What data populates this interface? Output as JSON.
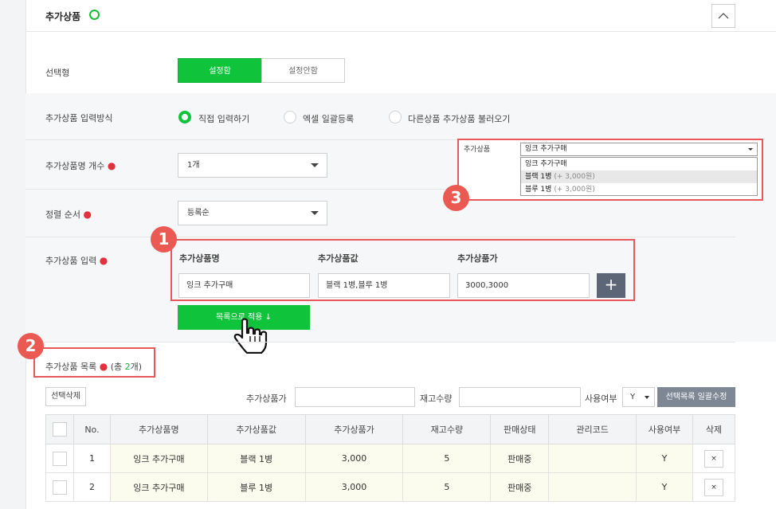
{
  "section": {
    "title": "추가상품"
  },
  "select_type": {
    "label": "선택형",
    "on_label": "설정함",
    "off_label": "설정안함"
  },
  "input_method": {
    "label": "추가상품 입력방식",
    "options": [
      "직접 입력하기",
      "엑셀 일괄등록",
      "다른상품 추가상품 불러오기"
    ],
    "selected": "직접 입력하기"
  },
  "name_count": {
    "label": "추가상품명 개수",
    "value": "1개"
  },
  "sort_order": {
    "label": "정렬 순서",
    "value": "등록순"
  },
  "product_input": {
    "label": "추가상품 입력",
    "columns": [
      "추가상품명",
      "추가상품값",
      "추가상품가"
    ],
    "values": [
      "잉크 추가구매",
      "블랙 1병,블루 1병",
      "3000,3000"
    ],
    "apply_label": "목록으로 적용 ↓"
  },
  "preview": {
    "label": "추가상품",
    "selected": "잉크 추가구매",
    "options": [
      {
        "text": "잉크 추가구매",
        "price": ""
      },
      {
        "text": "블랙 1병",
        "price": "(+ 3,000원)"
      },
      {
        "text": "블루 1병",
        "price": "(+ 3,000원)"
      }
    ]
  },
  "badges": [
    "1",
    "2",
    "3"
  ],
  "list": {
    "label": "추가상품 목록",
    "total_prefix": "(총 ",
    "total_count": "2",
    "total_suffix": "개)",
    "delete_selected": "선택삭제",
    "filter_price_label": "추가상품가",
    "filter_stock_label": "재고수량",
    "filter_use_label": "사용여부",
    "filter_use_value": "Y",
    "bulk_edit": "선택목록 일괄수정",
    "headers": [
      "No.",
      "추가상품명",
      "추가상품값",
      "추가상품가",
      "재고수량",
      "판매상태",
      "관리코드",
      "사용여부",
      "삭제"
    ],
    "rows": [
      {
        "no": "1",
        "name": "잉크 추가구매",
        "value": "블랙 1병",
        "price": "3,000",
        "stock": "5",
        "status": "판매중",
        "code": "",
        "use": "Y"
      },
      {
        "no": "2",
        "name": "잉크 추가구매",
        "value": "블루 1병",
        "price": "3,000",
        "stock": "5",
        "status": "판매중",
        "code": "",
        "use": "Y"
      }
    ],
    "delete_icon": "×"
  },
  "colors": {
    "accent": "#0fc43b",
    "badge": "#ea5a53",
    "required": "#e0323c"
  }
}
